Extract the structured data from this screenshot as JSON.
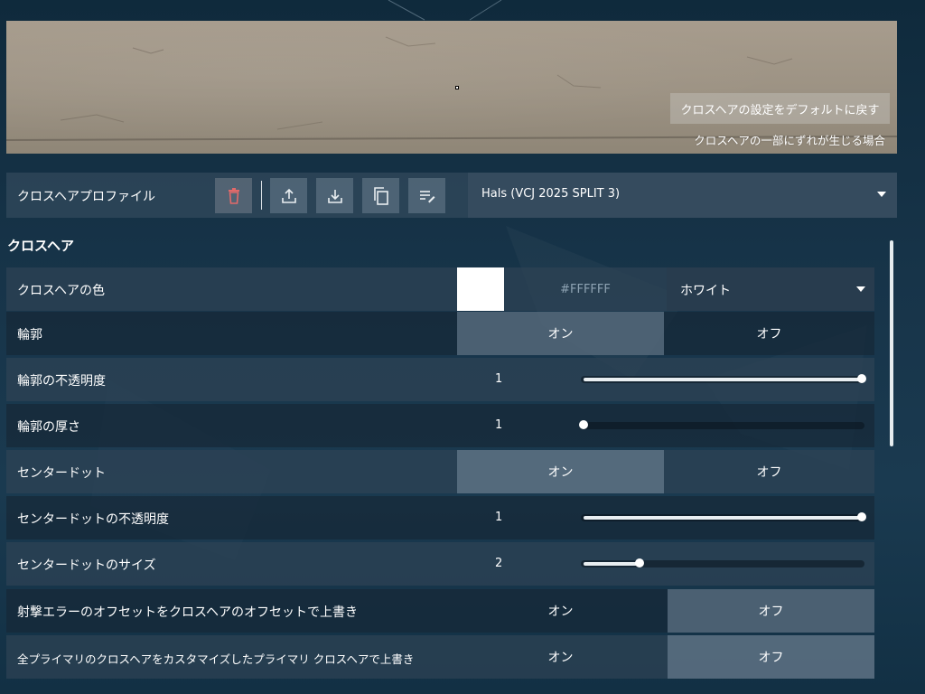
{
  "preview": {
    "reset_label": "クロスヘアの設定をデフォルトに戻す",
    "offset_note": "クロスヘアの一部にずれが生じる場合"
  },
  "profile": {
    "label": "クロスヘアプロファイル",
    "selected": "Hals (VCJ 2025 SPLIT 3)",
    "tools": [
      "trash-icon",
      "upload-icon",
      "download-icon",
      "copy-icon",
      "rename-icon"
    ]
  },
  "section": {
    "title": "クロスヘア"
  },
  "rows": {
    "color": {
      "label": "クロスヘアの色",
      "hex": "#FFFFFF",
      "selected": "ホワイト",
      "swatch": "#FFFFFF"
    },
    "outline": {
      "label": "輪郭",
      "on": "オン",
      "off": "オフ",
      "value": "on"
    },
    "outline_opacity": {
      "label": "輪郭の不透明度",
      "value": "1",
      "fraction": 1.0
    },
    "outline_thickness": {
      "label": "輪郭の厚さ",
      "value": "1",
      "fraction": 0.0
    },
    "center_dot": {
      "label": "センタードット",
      "on": "オン",
      "off": "オフ",
      "value": "on"
    },
    "center_dot_opacity": {
      "label": "センタードットの不透明度",
      "value": "1",
      "fraction": 1.0
    },
    "center_dot_size": {
      "label": "センタードットのサイズ",
      "value": "2",
      "fraction": 0.2
    },
    "override_offset": {
      "label": "射撃エラーのオフセットをクロスヘアのオフセットで上書き",
      "on": "オン",
      "off": "オフ",
      "value": "off"
    },
    "override_primary": {
      "label": "全プライマリのクロスヘアをカスタマイズしたプライマリ クロスヘアで上書き",
      "on": "オン",
      "off": "オフ",
      "value": "off"
    }
  }
}
